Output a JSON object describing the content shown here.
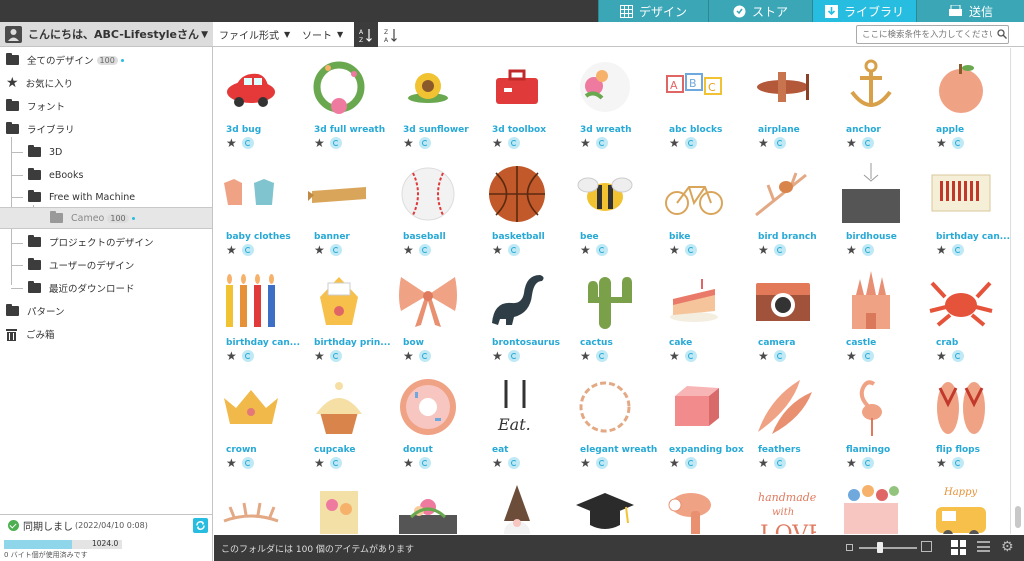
{
  "top_tabs": [
    {
      "label": "デザイン",
      "icon": "grid-icon"
    },
    {
      "label": "ストア",
      "icon": "store-icon"
    },
    {
      "label": "ライブラリ",
      "icon": "download-icon"
    },
    {
      "label": "送信",
      "icon": "send-icon"
    }
  ],
  "greeting": "こんにちは、ABC-Lifestyleさん",
  "toolbar": {
    "file_format": "ファイル形式",
    "sort": "ソート",
    "search_placeholder": "ここに検索条件を入力してください"
  },
  "sidebar": {
    "all_designs": "全てのデザイン",
    "all_designs_count": "100",
    "favorites": "お気に入り",
    "fonts": "フォント",
    "library": "ライブラリ",
    "folder_3d": "3D",
    "folder_ebooks": "eBooks",
    "folder_free": "Free with Machine",
    "folder_cameo": "Cameo",
    "folder_cameo_count": "100",
    "project_designs": "プロジェクトのデザイン",
    "user_designs": "ユーザーのデザイン",
    "recent_downloads": "最近のダウンロード",
    "patterns": "パターン",
    "trash": "ごみ箱"
  },
  "sync": {
    "label": "同期しまし",
    "date": "(2022/04/10 0:08)"
  },
  "usage": {
    "total": "1024.0",
    "text": "0 バイト個が使用済みです",
    "fraction": 0.58
  },
  "items": [
    "3d bug",
    "3d full wreath",
    "3d sunflower",
    "3d toolbox",
    "3d wreath",
    "abc blocks",
    "airplane",
    "anchor",
    "apple",
    "baby clothes",
    "banner",
    "baseball",
    "basketball",
    "bee",
    "bike",
    "bird branch",
    "birdhouse",
    "birthday can...",
    "birthday can...",
    "birthday prin...",
    "bow",
    "brontosaurus",
    "cactus",
    "cake",
    "camera",
    "castle",
    "crab",
    "crown",
    "cupcake",
    "donut",
    "eat",
    "elegant wreath",
    "expanding box",
    "feathers",
    "flamingo",
    "flip flops",
    "",
    "",
    "",
    "",
    "",
    "",
    "",
    "",
    ""
  ],
  "status": {
    "text": "このフォルダには 100 個のアイテムがあります"
  },
  "colors": {
    "accent": "#27bde0",
    "tab": "#3aa6b6",
    "dark": "#3a3a3a",
    "label": "#27a9d6"
  }
}
